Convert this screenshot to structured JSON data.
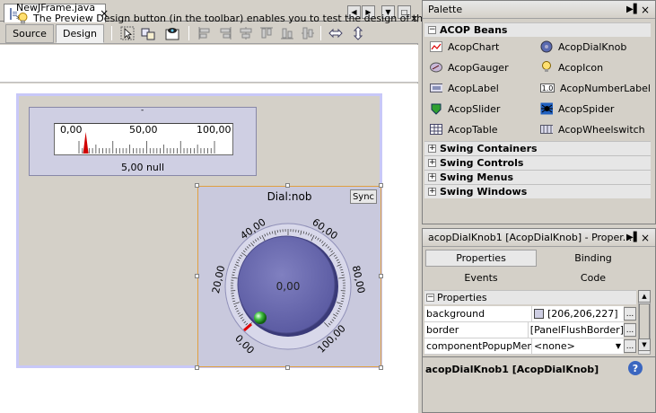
{
  "editor": {
    "file_tab": "NewJFrame.java *",
    "source_tab": "Source",
    "design_tab": "Design",
    "hint": "The Preview Design button (in the toolbar) enables you to test the design of the form.",
    "hint_close": "×"
  },
  "gauger": {
    "ticks": [
      "0,00",
      "50,00",
      "100,00"
    ],
    "value": 5.0,
    "range": [
      0,
      100
    ],
    "display": "5,00 null",
    "tick_mark": "-"
  },
  "dial": {
    "title": "Dial:nob",
    "sync": "Sync",
    "value_text": "0,00",
    "scale_labels": [
      "0,00",
      "20,00",
      "40,00",
      "60,00",
      "80,00",
      "100,00"
    ],
    "value": 0.0
  },
  "palette": {
    "title": "Palette",
    "acop_category": "ACOP Beans",
    "items": [
      {
        "label": "AcopChart",
        "icon": "chart-icon"
      },
      {
        "label": "AcopDialKnob",
        "icon": "dialknob-icon"
      },
      {
        "label": "AcopGauger",
        "icon": "gauger-icon"
      },
      {
        "label": "AcopIcon",
        "icon": "bulb-icon"
      },
      {
        "label": "AcopLabel",
        "icon": "label-icon"
      },
      {
        "label": "AcopNumberLabel",
        "icon": "number-label-icon"
      },
      {
        "label": "AcopSlider",
        "icon": "slider-icon"
      },
      {
        "label": "AcopSpider",
        "icon": "spider-icon"
      },
      {
        "label": "AcopTable",
        "icon": "table-icon"
      },
      {
        "label": "AcopWheelswitch",
        "icon": "wheelswitch-icon"
      }
    ],
    "categories": [
      "Swing Containers",
      "Swing Controls",
      "Swing Menus",
      "Swing Windows"
    ],
    "expanded_symbol": "−",
    "collapsed_symbol": "+"
  },
  "properties": {
    "title": "acopDialKnob1 [AcopDialKnob] - Proper...",
    "tabs": [
      "Properties",
      "Binding",
      "Events",
      "Code"
    ],
    "section": "Properties",
    "rows": [
      {
        "key": "background",
        "value": "[206,206,227]"
      },
      {
        "key": "border",
        "value": "[PanelFlushBorder]"
      },
      {
        "key": "componentPopupMenu",
        "value": "<none>"
      }
    ],
    "selected_label": "acopDialKnob1 [AcopDialKnob]",
    "swatch_color": "#cecee3",
    "ellipsis": "..."
  }
}
